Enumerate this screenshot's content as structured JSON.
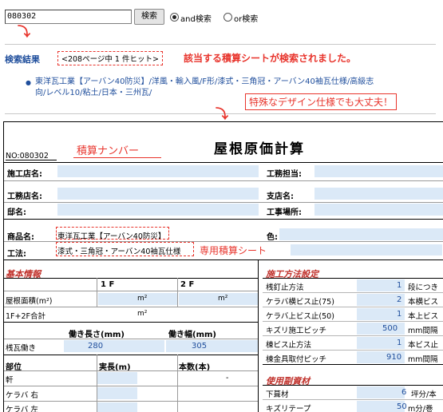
{
  "search": {
    "value": "080302",
    "button_label": "検索",
    "and_label": "and検索",
    "or_label": "or検索",
    "selected": "and"
  },
  "results": {
    "title": "検索結果",
    "hit_info": "<208ページ中 1 件ヒット>",
    "annotation": "該当する積算シートが検索されました。",
    "item_line1": "東洋瓦工業【アーバン40防災】/洋風・輸入風/F形/漆式・三角冠・アーバン40袖瓦仕様/高級志",
    "item_line2": "向/レベル10/粘土/日本・三州瓦/",
    "design_note": "特殊なデザイン仕様でも大丈夫！"
  },
  "sheet": {
    "number_label": "NO:080302",
    "number_annotation": "積算ナンバー",
    "title": "屋根原価計算",
    "labels": {
      "builder": "施工店名:",
      "manager": "工務担当:",
      "contractor": "工務店名:",
      "branch": "支店名:",
      "owner": "邸名:",
      "site": "工事場所:",
      "product": "商品名:",
      "product_value": "東洋瓦工業【アーバン40防災】",
      "color": "色:",
      "method": "工法:",
      "method_value": "漆式・三角冠・アーバン40袖瓦仕様",
      "method_annotation": "専用積算シート"
    },
    "basic": {
      "title": "基本情報",
      "col_1f": "1 F",
      "col_2f": "2 F",
      "roof_area_label": "屋根面積(m²)",
      "unit1": "m²",
      "unit2": "m²",
      "total_label": "1F+2F合計",
      "unit3": "m²",
      "wl_header": "働き長さ(mm)",
      "ww_header": "働き幅(mm)",
      "tile_label": "桟瓦働き",
      "tile_length": "280",
      "tile_width": "305"
    },
    "parts": {
      "col_part": "部位",
      "col_length": "実長(m)",
      "col_count": "本数(本)",
      "rows": [
        "軒",
        "ケラバ 右",
        "ケラバ 左"
      ],
      "eaves_count": "-"
    },
    "method_settings": {
      "title": "施工方法設定",
      "rows": [
        {
          "label": "桟釘止方法",
          "value": "1",
          "unit": "段につき"
        },
        {
          "label": "ケラバ横ビス止(75)",
          "value": "2",
          "unit": "本横ビス"
        },
        {
          "label": "ケラバ上ビス止(50)",
          "value": "1",
          "unit": "本上ビス"
        },
        {
          "label": "キズリ施工ピッチ",
          "value": "500",
          "unit": "mm間隔"
        },
        {
          "label": "棟ビス止方法",
          "value": "1",
          "unit": "本ビス止"
        },
        {
          "label": "棟金具取付ピッチ",
          "value": "910",
          "unit": "mm間隔"
        }
      ]
    },
    "materials": {
      "title": "使用副資材",
      "rows": [
        {
          "label": "下葺材",
          "value": "6",
          "unit": "坪分/本"
        },
        {
          "label": "キズリテープ",
          "value": "50",
          "unit": "m分/巻"
        }
      ]
    }
  }
}
